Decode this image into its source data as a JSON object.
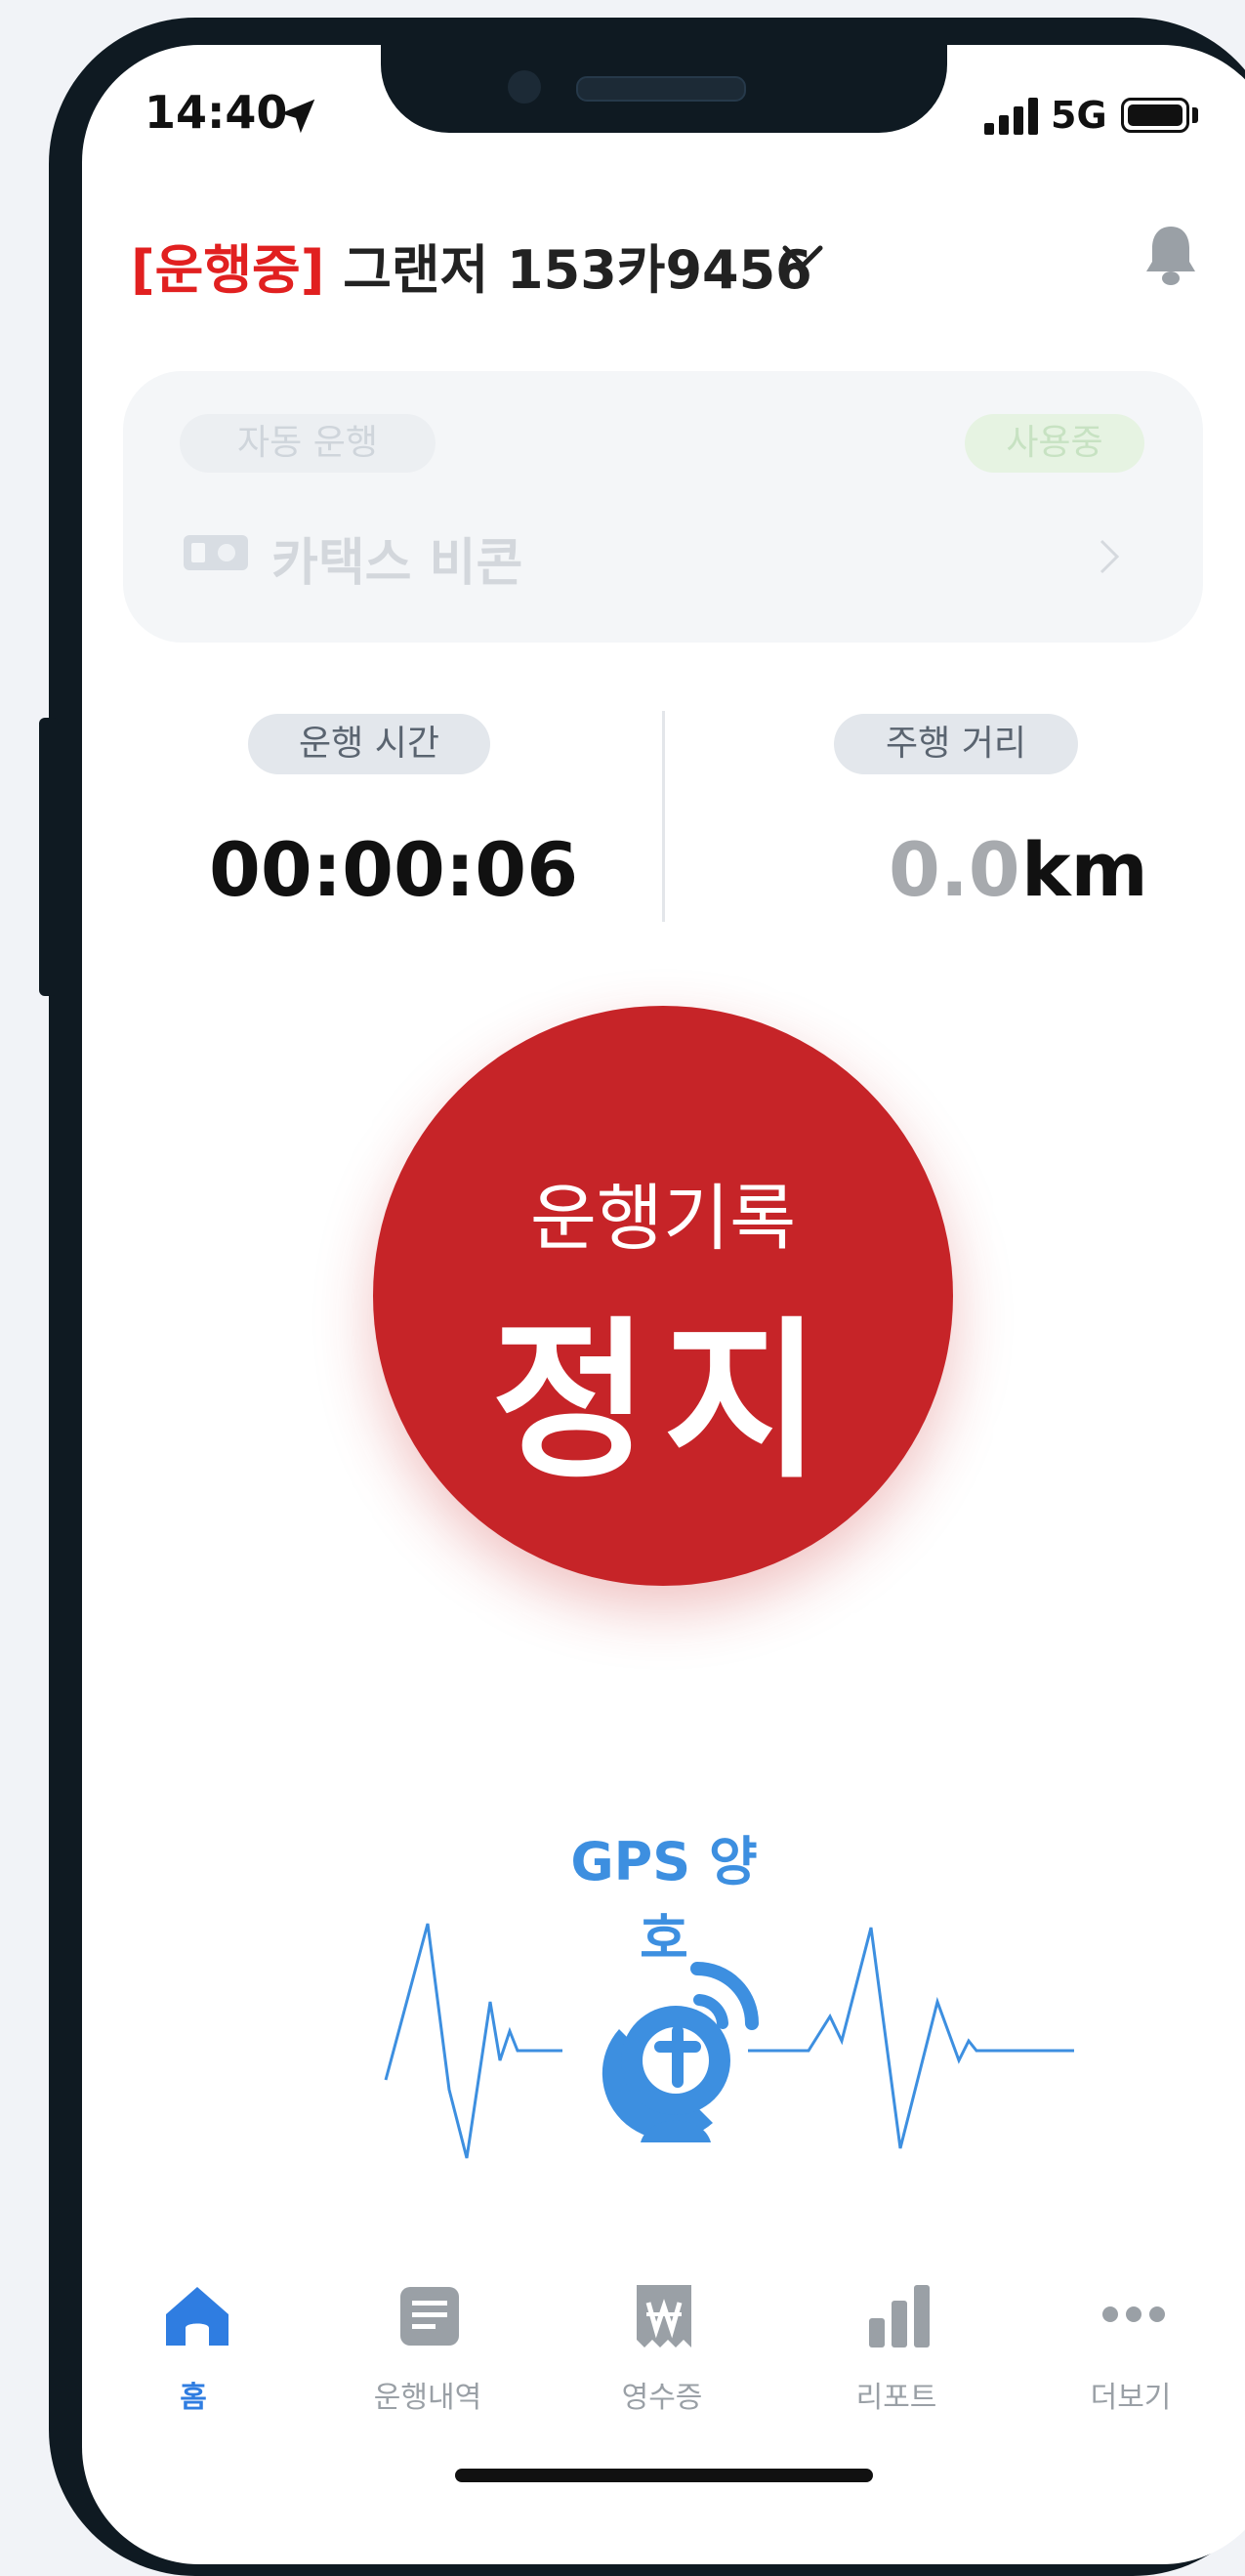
{
  "status_bar": {
    "time": "14:40",
    "network": "5G"
  },
  "header": {
    "status_tag": "[운행중]",
    "vehicle": "그랜저 153카9456"
  },
  "auto_drive_card": {
    "tag": "자동 운행",
    "status": "사용중",
    "device_label": "카택스 비콘"
  },
  "stats": {
    "time_label": "운행 시간",
    "time_value": "00:00:06",
    "distance_label": "주행 거리",
    "distance_value": "0.0",
    "distance_unit": "km"
  },
  "record_button": {
    "top": "운행기록",
    "main": "정지"
  },
  "gps": {
    "label": "GPS 양호"
  },
  "tabs": [
    {
      "label": "홈",
      "icon": "home-icon",
      "active": true
    },
    {
      "label": "운행내역",
      "icon": "document-icon",
      "active": false
    },
    {
      "label": "영수증",
      "icon": "receipt-won-icon",
      "active": false
    },
    {
      "label": "리포트",
      "icon": "bar-chart-icon",
      "active": false
    },
    {
      "label": "더보기",
      "icon": "more-dots-icon",
      "active": false
    }
  ],
  "colors": {
    "accent": "#2f7de1",
    "stop_red": "#c62428",
    "status_red": "#e12020",
    "gps_blue": "#3d8fe0"
  }
}
